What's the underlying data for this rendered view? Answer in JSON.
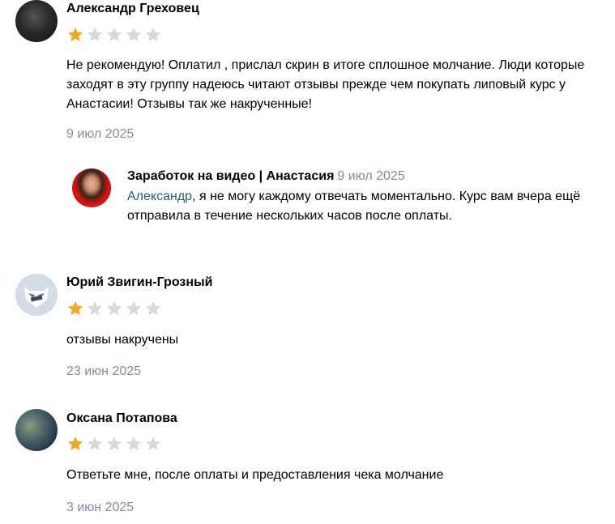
{
  "reviews": [
    {
      "author": "Александр Греховец",
      "rating": 1,
      "max_rating": 5,
      "text": "Не рекомендую! Оплатил , прислал скрин в итоге сплошное молчание. Люди которые заходят в эту группу надеюсь читают отзывы прежде чем покупать липовый курс у Анастасии! Отзывы так же накрученные!",
      "date": "9 июл 2025",
      "reply": {
        "author": "Заработок на видео | Анастасия",
        "date": "9 июл 2025",
        "mention": "Александр",
        "text": ", я не могу каждому отвечать моментально. Курс вам вчера ещё отправила в течение нескольких часов после оплаты."
      }
    },
    {
      "author": "Юрий Звигин-Грозный",
      "rating": 1,
      "max_rating": 5,
      "text": "отзывы накручены",
      "date": "23 июн 2025"
    },
    {
      "author": "Оксана Потапова",
      "rating": 1,
      "max_rating": 5,
      "text": "Ответьте мне, после оплаты и предоставления чека молчание",
      "date": "3 июн 2025"
    }
  ],
  "colors": {
    "star_filled": "#f5a623",
    "star_empty": "#d6dae0",
    "date": "#818c99",
    "mention": "#2a5885"
  }
}
